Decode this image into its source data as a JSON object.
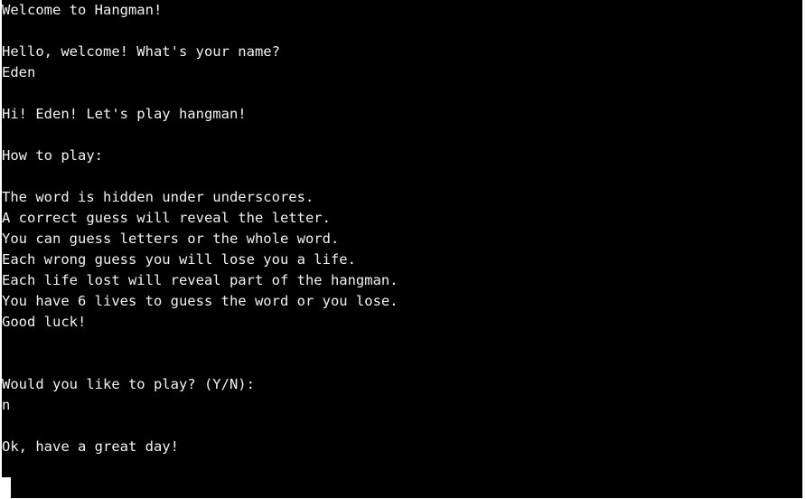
{
  "terminal": {
    "background_color": "#000000",
    "text_color": "#f2f2f2",
    "lines": {
      "l0": "Welcome to Hangman!",
      "l2": "Hello, welcome! What's your name?",
      "l3": "Eden",
      "l5": "Hi! Eden! Let's play hangman!",
      "l7": "How to play:",
      "l9": "The word is hidden under underscores.",
      "l10": "A correct guess will reveal the letter.",
      "l11": "You can guess letters or the whole word.",
      "l12": "Each wrong guess you will lose you a life.",
      "l13": "Each life lost will reveal part of the hangman.",
      "l14": "You have 6 lives to guess the word or you lose.",
      "l15": "Good luck!",
      "l18": "Would you like to play? (Y/N):",
      "l19": "n",
      "l21": "Ok, have a great day!"
    }
  }
}
